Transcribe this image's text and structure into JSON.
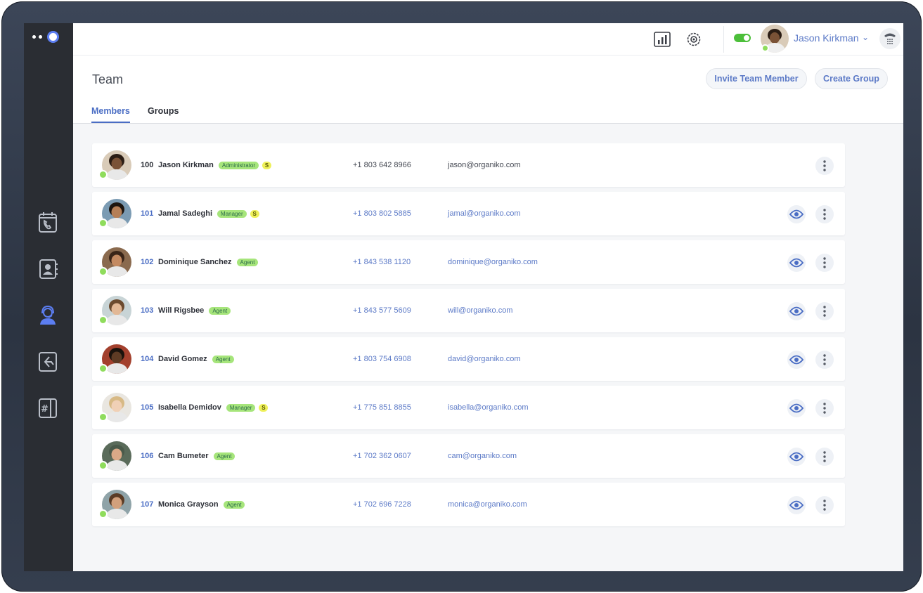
{
  "user": {
    "name": "Jason Kirkman",
    "chevron": "⌄",
    "status": "online"
  },
  "header": {
    "title": "Team",
    "invite_label": "Invite Team Member",
    "create_group_label": "Create Group",
    "tabs": [
      {
        "label": "Members",
        "active": true
      },
      {
        "label": "Groups",
        "active": false
      }
    ]
  },
  "members": [
    {
      "ext": "100",
      "name": "Jason Kirkman",
      "role": "Administrator",
      "s": "S",
      "phone": "+1 803 642 8966",
      "email": "jason@organiko.com",
      "skin": "#7a5236",
      "hair": "#2b1d14",
      "bg": "#d9cbb8"
    },
    {
      "ext": "101",
      "name": "Jamal Sadeghi",
      "role": "Manager",
      "s": "S",
      "phone": "+1 803 802 5885",
      "email": "jamal@organiko.com",
      "skin": "#b57f57",
      "hair": "#1c1510",
      "bg": "#7b9bb3"
    },
    {
      "ext": "102",
      "name": "Dominique Sanchez",
      "role": "Agent",
      "s": "",
      "phone": "+1 843 538 1120",
      "email": "dominique@organiko.com",
      "skin": "#c48a61",
      "hair": "#3a2518",
      "bg": "#8a6a4e"
    },
    {
      "ext": "103",
      "name": "Will Rigsbee",
      "role": "Agent",
      "s": "",
      "phone": "+1 843 577 5609",
      "email": "will@organiko.com",
      "skin": "#e2b896",
      "hair": "#6b4a2e",
      "bg": "#c8d4d6"
    },
    {
      "ext": "104",
      "name": "David Gomez",
      "role": "Agent",
      "s": "",
      "phone": "+1 803 754 6908",
      "email": "david@organiko.com",
      "skin": "#5e3b24",
      "hair": "#1a120c",
      "bg": "#a3402d"
    },
    {
      "ext": "105",
      "name": "Isabella Demidov",
      "role": "Manager",
      "s": "S",
      "phone": "+1 775 851 8855",
      "email": "isabella@organiko.com",
      "skin": "#f0d0b6",
      "hair": "#d7b985",
      "bg": "#e9e6e0"
    },
    {
      "ext": "106",
      "name": "Cam Bumeter",
      "role": "Agent",
      "s": "",
      "phone": "+1 702 362 0607",
      "email": "cam@organiko.com",
      "skin": "#d9a987",
      "hair": "#4a5a4a",
      "bg": "#5a6b5a"
    },
    {
      "ext": "107",
      "name": "Monica Grayson",
      "role": "Agent",
      "s": "",
      "phone": "+1 702 696 7228",
      "email": "monica@organiko.com",
      "skin": "#d2a07c",
      "hair": "#5a3b25",
      "bg": "#8fa3a8"
    }
  ],
  "colors": {
    "accent": "#4a6dc4",
    "sidebar": "#2a2d33",
    "online": "#8fdc5c",
    "role_badge": "#a6e57b",
    "s_badge": "#eef05a"
  }
}
